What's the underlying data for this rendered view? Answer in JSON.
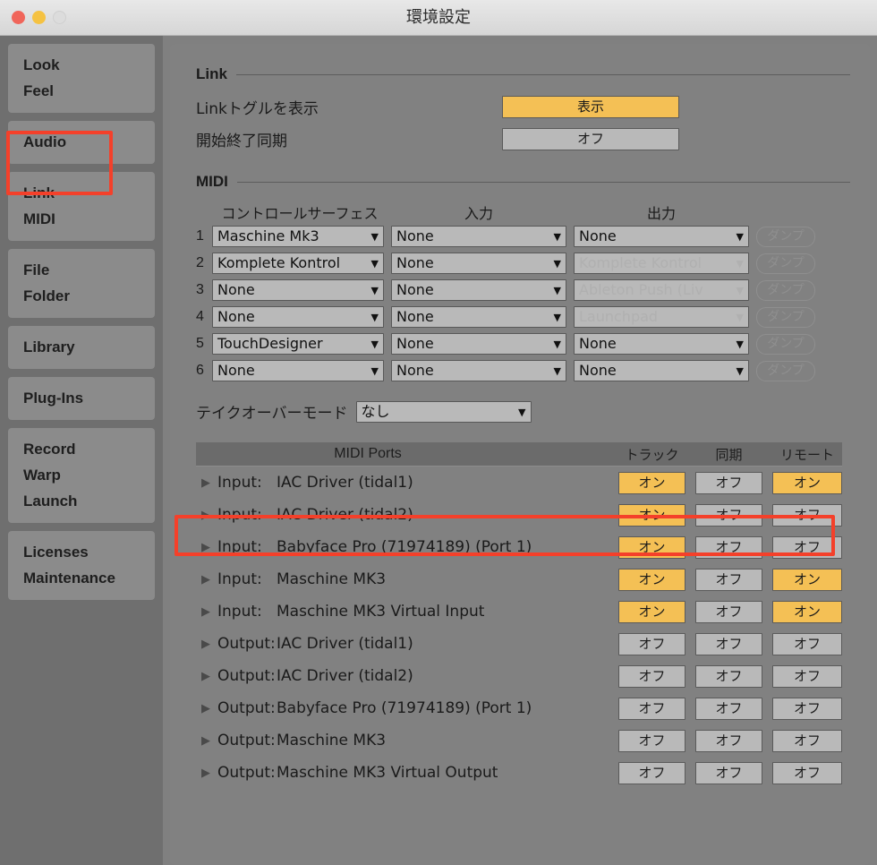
{
  "window": {
    "title": "環境設定",
    "traffic_lights": [
      "close",
      "minimize",
      "zoom"
    ]
  },
  "sidebar": {
    "groups": [
      {
        "items": [
          "Look",
          "Feel"
        ]
      },
      {
        "items": [
          "Audio"
        ]
      },
      {
        "items": [
          "Link",
          "MIDI"
        ],
        "selected": true
      },
      {
        "items": [
          "File",
          "Folder"
        ]
      },
      {
        "items": [
          "Library"
        ]
      },
      {
        "items": [
          "Plug-Ins"
        ]
      },
      {
        "items": [
          "Record",
          "Warp",
          "Launch"
        ]
      },
      {
        "items": [
          "Licenses",
          "Maintenance"
        ]
      }
    ]
  },
  "link_section": {
    "heading": "Link",
    "rows": [
      {
        "label": "Linkトグルを表示",
        "value": "表示",
        "state": "on"
      },
      {
        "label": "開始終了同期",
        "value": "オフ",
        "state": "off"
      }
    ]
  },
  "midi_section": {
    "heading": "MIDI",
    "control_surfaces": {
      "headers": [
        "コントロールサーフェス",
        "入力",
        "出力"
      ],
      "dump_label": "ダンプ",
      "rows": [
        {
          "index": "1",
          "surface": "Maschine Mk3",
          "input": "None",
          "output": "None",
          "output_ghost": false
        },
        {
          "index": "2",
          "surface": "Komplete Kontrol",
          "input": "None",
          "output": "Komplete Kontrol",
          "output_ghost": true
        },
        {
          "index": "3",
          "surface": "None",
          "input": "None",
          "output": "Ableton Push (Liv",
          "output_ghost": true
        },
        {
          "index": "4",
          "surface": "None",
          "input": "None",
          "output": "Launchpad",
          "output_ghost": true
        },
        {
          "index": "5",
          "surface": "TouchDesigner",
          "input": "None",
          "output": "None",
          "output_ghost": false
        },
        {
          "index": "6",
          "surface": "None",
          "input": "None",
          "output": "None",
          "output_ghost": false
        }
      ]
    },
    "takeover": {
      "label": "テイクオーバーモード",
      "value": "なし"
    },
    "ports": {
      "title": "MIDI Ports",
      "columns": [
        "トラック",
        "同期",
        "リモート"
      ],
      "rows": [
        {
          "direction": "Input:",
          "name": "IAC Driver (tidal1)",
          "track": "オン",
          "sync": "オフ",
          "remote": "オン",
          "highlighted": true
        },
        {
          "direction": "Input:",
          "name": "IAC Driver (tidal2)",
          "track": "オン",
          "sync": "オフ",
          "remote": "オフ",
          "highlighted": false
        },
        {
          "direction": "Input:",
          "name": "Babyface Pro (71974189) (Port 1)",
          "track": "オン",
          "sync": "オフ",
          "remote": "オフ",
          "highlighted": false
        },
        {
          "direction": "Input:",
          "name": "Maschine MK3",
          "track": "オン",
          "sync": "オフ",
          "remote": "オン",
          "highlighted": false
        },
        {
          "direction": "Input:",
          "name": "Maschine MK3 Virtual Input",
          "track": "オン",
          "sync": "オフ",
          "remote": "オン",
          "highlighted": false
        },
        {
          "direction": "Output:",
          "name": "IAC Driver (tidal1)",
          "track": "オフ",
          "sync": "オフ",
          "remote": "オフ",
          "highlighted": false
        },
        {
          "direction": "Output:",
          "name": "IAC Driver (tidal2)",
          "track": "オフ",
          "sync": "オフ",
          "remote": "オフ",
          "highlighted": false
        },
        {
          "direction": "Output:",
          "name": "Babyface Pro (71974189) (Port 1)",
          "track": "オフ",
          "sync": "オフ",
          "remote": "オフ",
          "highlighted": false
        },
        {
          "direction": "Output:",
          "name": "Maschine MK3",
          "track": "オフ",
          "sync": "オフ",
          "remote": "オフ",
          "highlighted": false
        },
        {
          "direction": "Output:",
          "name": "Maschine MK3 Virtual Output",
          "track": "オフ",
          "sync": "オフ",
          "remote": "オフ",
          "highlighted": false
        }
      ]
    }
  },
  "icons": {
    "disclosure": "▶",
    "caret_down": "▼"
  },
  "colors": {
    "accent_on": "#f4c055",
    "off": "#b9b9b9",
    "annotation": "#f4402a",
    "panel": "#818181",
    "sidebar": "#6f6f6f",
    "sidebar_item": "#8b8b8b"
  }
}
